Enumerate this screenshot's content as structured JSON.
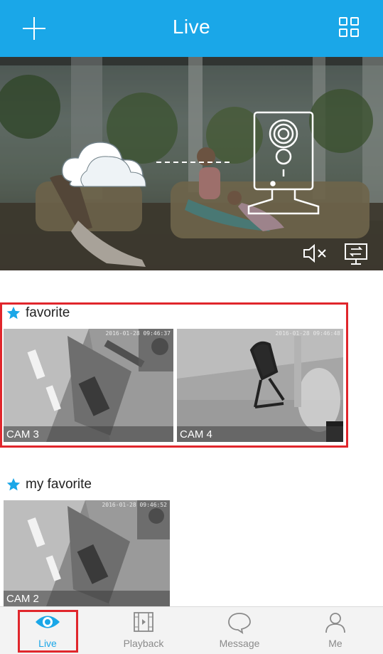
{
  "header": {
    "title": "Live",
    "add_icon": "plus-icon",
    "layout_icon": "grid-icon",
    "background_color": "#1aa7e8"
  },
  "banner": {
    "mute_icon": "speaker-mute-icon",
    "screen_icon": "monitor-switch-icon"
  },
  "groups": [
    {
      "title": "favorite",
      "icon": "star-icon",
      "cameras": [
        {
          "label": "CAM 3",
          "timestamp": "2016-01-28 09:46:37"
        },
        {
          "label": "CAM 4",
          "timestamp": "2016-01-28 09:46:48"
        }
      ]
    },
    {
      "title": "my favorite",
      "icon": "star-icon",
      "cameras": [
        {
          "label": "CAM 2",
          "timestamp": "2016-01-28 09:46:52"
        }
      ]
    }
  ],
  "bottom_nav": [
    {
      "label": "Live",
      "icon": "eye-icon",
      "active": true
    },
    {
      "label": "Playback",
      "icon": "film-play-icon",
      "active": false
    },
    {
      "label": "Message",
      "icon": "chat-bubble-icon",
      "active": false
    },
    {
      "label": "Me",
      "icon": "user-icon",
      "active": false
    }
  ],
  "colors": {
    "accent": "#1aa7e8",
    "highlight": "#e0262c",
    "inactive": "#8a8a8a"
  }
}
